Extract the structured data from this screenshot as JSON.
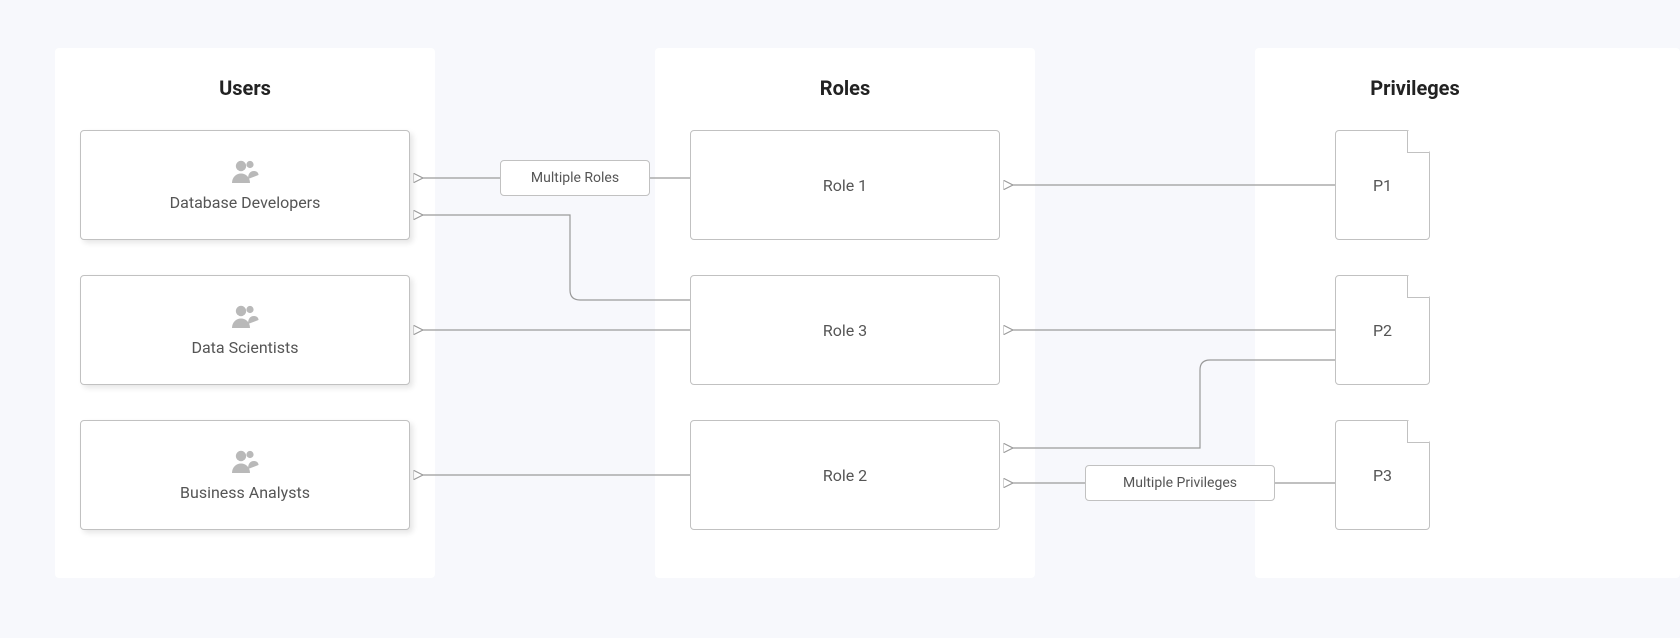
{
  "columns": {
    "users": {
      "title": "Users"
    },
    "roles": {
      "title": "Roles"
    },
    "privileges": {
      "title": "Privileges"
    }
  },
  "users": [
    {
      "label": "Database Developers"
    },
    {
      "label": "Data Scientists"
    },
    {
      "label": "Business Analysts"
    }
  ],
  "roles": [
    {
      "label": "Role 1"
    },
    {
      "label": "Role 3"
    },
    {
      "label": "Role 2"
    }
  ],
  "privileges": [
    {
      "label": "P1"
    },
    {
      "label": "P2"
    },
    {
      "label": "P3"
    }
  ],
  "edge_labels": {
    "multiple_roles": "Multiple Roles",
    "multiple_privileges": "Multiple Privileges"
  }
}
